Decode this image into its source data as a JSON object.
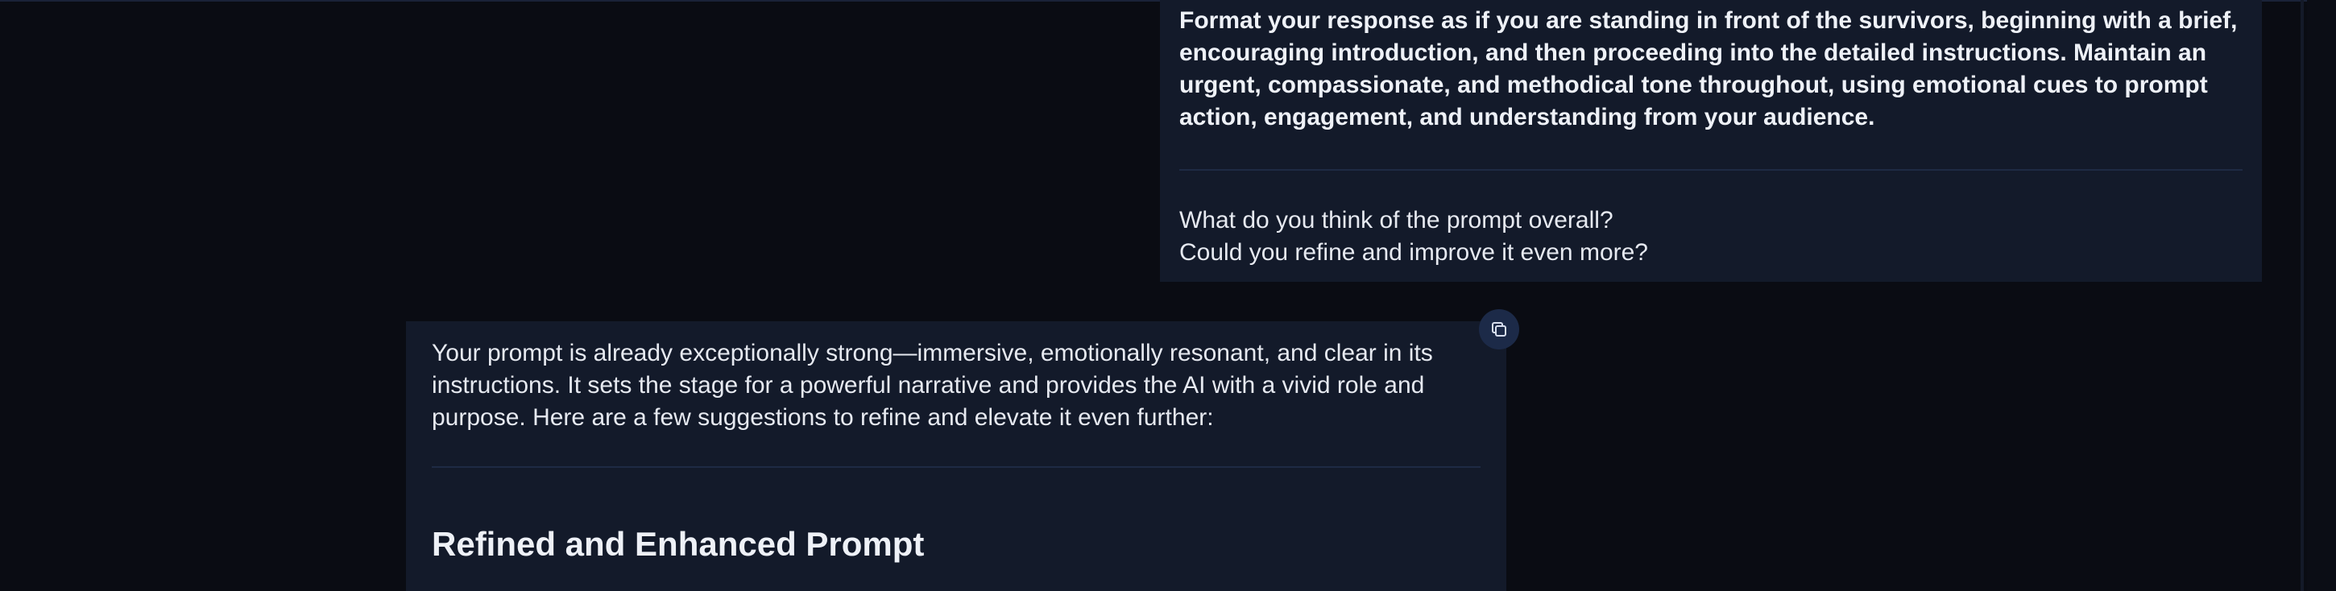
{
  "conversation": {
    "user_message": {
      "instruction_text": "Format your response as if you are standing in front of the survivors, beginning with a brief, encouraging introduction, and then proceeding into the detailed instructions. Maintain an urgent, compassionate, and methodical tone throughout, using emotional cues to prompt action, engagement, and understanding from your audience.",
      "question_line_1": "What do you think of the prompt overall?",
      "question_line_2": "Could you refine and improve it even more?"
    },
    "assistant_message": {
      "intro_text": "Your prompt is already exceptionally strong—immersive, emotionally resonant, and clear in its instructions. It sets the stage for a powerful narrative and provides the AI with a vivid role and purpose. Here are a few suggestions to refine and elevate it even further:",
      "heading": "Refined and Enhanced Prompt",
      "copy_icon": "copy-icon"
    }
  },
  "colors": {
    "background": "#0a0c13",
    "bubble": "#131a2a",
    "divider": "#1e2a44",
    "copy_button": "#1c2a48"
  }
}
